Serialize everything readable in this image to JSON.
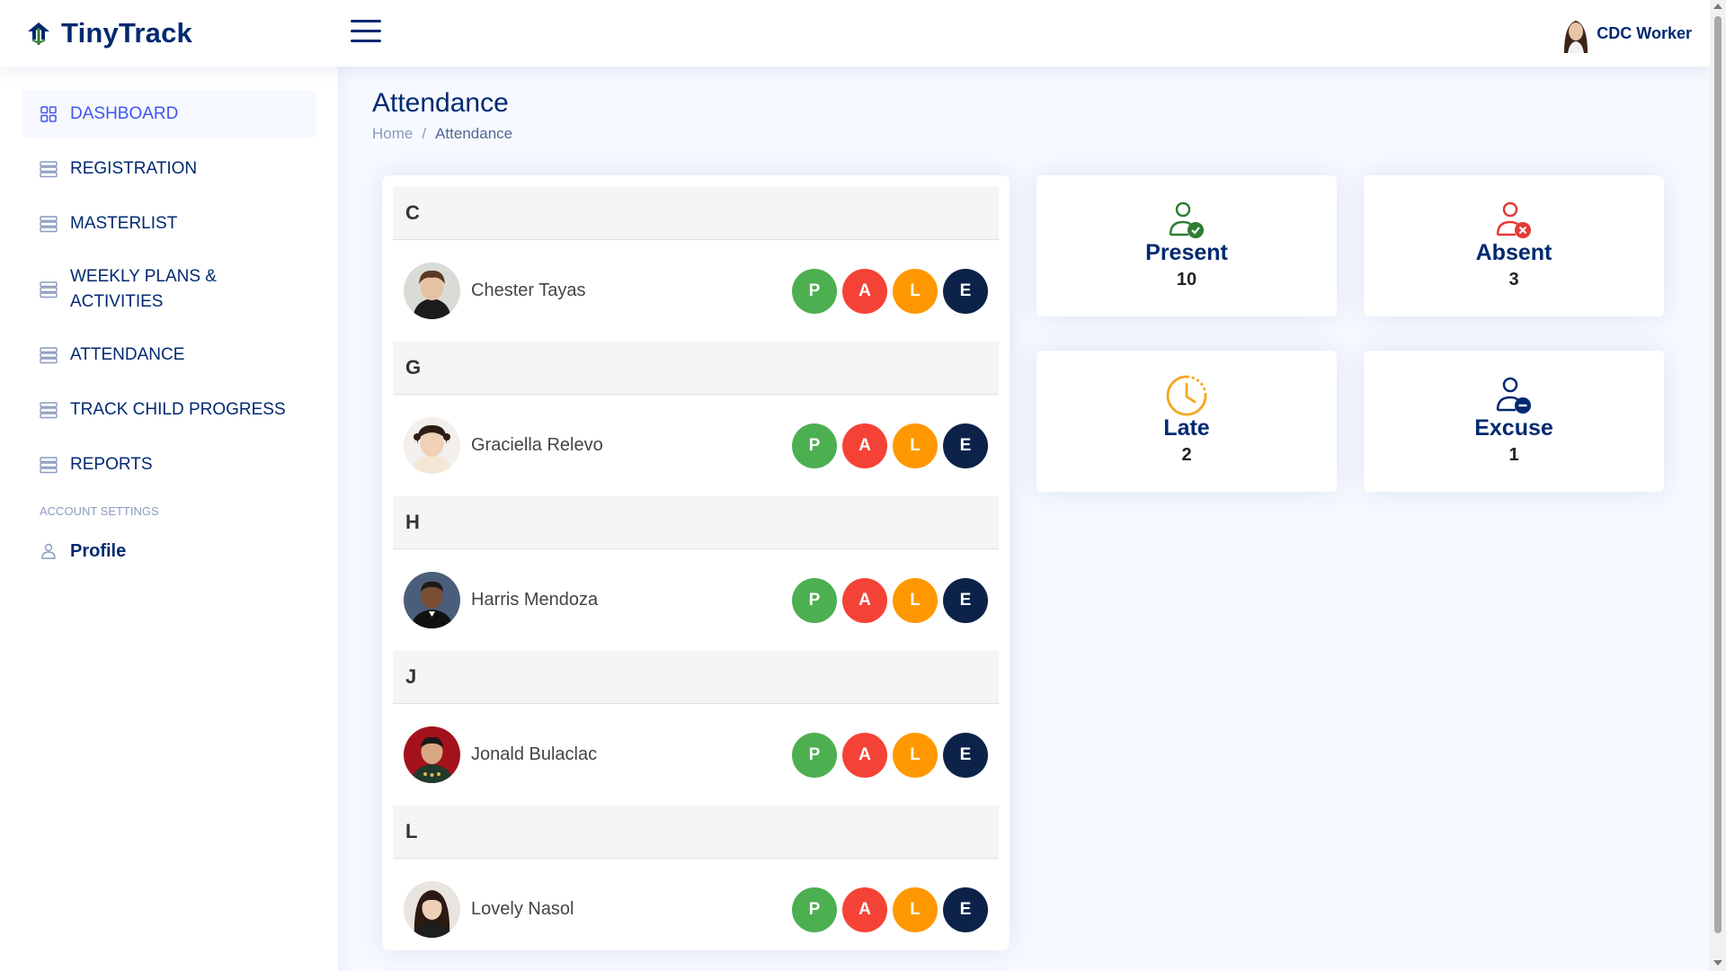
{
  "app": {
    "name": "TinyTrack"
  },
  "header": {
    "user_name": "CDC Worker"
  },
  "sidebar": {
    "items": [
      {
        "label": "DASHBOARD"
      },
      {
        "label": "REGISTRATION"
      },
      {
        "label": "MASTERLIST"
      },
      {
        "label": "WEEKLY PLANS &",
        "label2": "ACTIVITIES"
      },
      {
        "label": "ATTENDANCE"
      },
      {
        "label": "TRACK CHILD PROGRESS"
      },
      {
        "label": "REPORTS"
      }
    ],
    "section_heading": "ACCOUNT SETTINGS",
    "profile_label": "Profile"
  },
  "page": {
    "title": "Attendance",
    "breadcrumb": {
      "home": "Home",
      "separator": "/",
      "current": "Attendance"
    }
  },
  "attendance_list": {
    "groups": [
      {
        "letter": "C",
        "child": "Chester Tayas"
      },
      {
        "letter": "G",
        "child": "Graciella Relevo"
      },
      {
        "letter": "H",
        "child": "Harris Mendoza"
      },
      {
        "letter": "J",
        "child": "Jonald Bulaclac"
      },
      {
        "letter": "L",
        "child": "Lovely Nasol"
      }
    ],
    "status_buttons": {
      "present": "P",
      "absent": "A",
      "late": "L",
      "excuse": "E"
    },
    "status_colors": {
      "present": "#4caf50",
      "absent": "#f44336",
      "late": "#ff9800",
      "excuse": "#0d2249"
    }
  },
  "summary": {
    "present": {
      "label": "Present",
      "value": "10",
      "color": "#2e7d32"
    },
    "absent": {
      "label": "Absent",
      "value": "3",
      "color": "#e53935"
    },
    "late": {
      "label": "Late",
      "value": "2",
      "color": "#f5a623"
    },
    "excuse": {
      "label": "Excuse",
      "value": "1",
      "color": "#012970"
    }
  },
  "theme": {
    "primary": "#012970",
    "accent": "#4154f1"
  }
}
